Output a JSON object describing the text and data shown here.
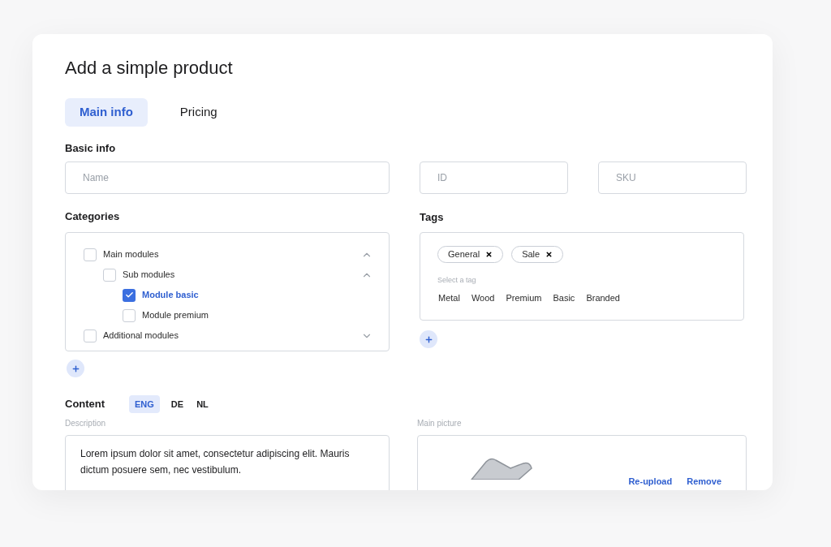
{
  "title": "Add a simple product",
  "tabs": [
    {
      "label": "Main info",
      "selected": true
    },
    {
      "label": "Pricing",
      "selected": false
    }
  ],
  "basic_info": {
    "heading": "Basic info",
    "fields": [
      {
        "placeholder": "Name"
      },
      {
        "placeholder": "ID"
      },
      {
        "placeholder": "SKU"
      }
    ]
  },
  "categories": {
    "heading": "Categories",
    "items": [
      {
        "label": "Main modules",
        "checked": false,
        "expanded": true,
        "children": [
          {
            "label": "Sub modules",
            "checked": false,
            "expanded": true,
            "children": [
              {
                "label": "Module basic",
                "checked": true
              },
              {
                "label": "Module premium",
                "checked": false
              }
            ]
          }
        ]
      },
      {
        "label": "Additional modules",
        "checked": false,
        "expanded": false
      }
    ]
  },
  "tags": {
    "heading": "Tags",
    "selected": [
      "General",
      "Sale"
    ],
    "select_label": "Select a tag",
    "options": [
      "Metal",
      "Wood",
      "Premium",
      "Basic",
      "Branded"
    ]
  },
  "content": {
    "heading": "Content",
    "languages": [
      {
        "label": "ENG",
        "selected": true
      },
      {
        "label": "DE",
        "selected": false
      },
      {
        "label": "NL",
        "selected": false
      }
    ],
    "description_label": "Description",
    "description": "Lorem ipsum dolor sit amet, consectetur adipiscing elit. Mauris dictum posuere sem, nec vestibulum.",
    "picture_label": "Main picture",
    "picture_actions": [
      "Re-upload",
      "Remove"
    ]
  }
}
